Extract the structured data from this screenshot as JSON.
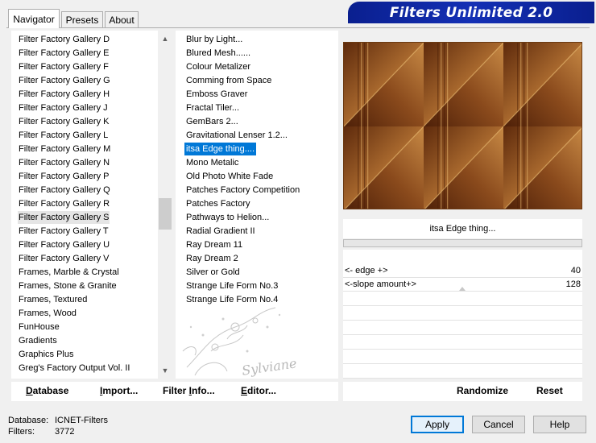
{
  "tabs": [
    {
      "label": "Navigator"
    },
    {
      "label": "Presets"
    },
    {
      "label": "About"
    }
  ],
  "banner": {
    "title": "Filters Unlimited 2.0"
  },
  "categories": [
    {
      "label": "Filter Factory Gallery D"
    },
    {
      "label": "Filter Factory Gallery E"
    },
    {
      "label": "Filter Factory Gallery F"
    },
    {
      "label": "Filter Factory Gallery G"
    },
    {
      "label": "Filter Factory Gallery H"
    },
    {
      "label": "Filter Factory Gallery J"
    },
    {
      "label": "Filter Factory Gallery K"
    },
    {
      "label": "Filter Factory Gallery L"
    },
    {
      "label": "Filter Factory Gallery M"
    },
    {
      "label": "Filter Factory Gallery N"
    },
    {
      "label": "Filter Factory Gallery P"
    },
    {
      "label": "Filter Factory Gallery Q"
    },
    {
      "label": "Filter Factory Gallery R"
    },
    {
      "label": "Filter Factory Gallery S"
    },
    {
      "label": "Filter Factory Gallery T"
    },
    {
      "label": "Filter Factory Gallery U"
    },
    {
      "label": "Filter Factory Gallery V"
    },
    {
      "label": "Frames, Marble & Crystal"
    },
    {
      "label": "Frames, Stone & Granite"
    },
    {
      "label": "Frames, Textured"
    },
    {
      "label": "Frames, Wood"
    },
    {
      "label": "FunHouse"
    },
    {
      "label": "Gradients"
    },
    {
      "label": "Graphics Plus"
    },
    {
      "label": "Greg's Factory Output Vol. II"
    }
  ],
  "selected_category": "Filter Factory Gallery S",
  "filters": [
    {
      "label": "Blur by Light..."
    },
    {
      "label": "Blured Mesh......"
    },
    {
      "label": "Colour Metalizer"
    },
    {
      "label": "Comming from Space"
    },
    {
      "label": "Emboss Graver"
    },
    {
      "label": "Fractal Tiler..."
    },
    {
      "label": "GemBars 2..."
    },
    {
      "label": "Gravitational Lenser 1.2..."
    },
    {
      "label": "itsa Edge thing...."
    },
    {
      "label": "Mono Metalic"
    },
    {
      "label": "Old Photo White Fade"
    },
    {
      "label": "Patches Factory Competition"
    },
    {
      "label": "Patches Factory"
    },
    {
      "label": "Pathways to Helion..."
    },
    {
      "label": "Radial Gradient II"
    },
    {
      "label": "Ray Dream 11"
    },
    {
      "label": "Ray Dream 2"
    },
    {
      "label": "Silver or Gold"
    },
    {
      "label": "Strange Life Form No.3"
    },
    {
      "label": "Strange Life Form No.4"
    }
  ],
  "selected_filter": "itsa Edge thing....",
  "watermark": {
    "text": "Sylviane"
  },
  "effect": {
    "name": "itsa Edge thing..."
  },
  "parameters": [
    {
      "label": "<- edge +>",
      "value": "40"
    },
    {
      "label": "<-slope amount+>",
      "value": "128"
    }
  ],
  "toolbar": {
    "database": {
      "first": "D",
      "rest": "atabase"
    },
    "import": {
      "first": "I",
      "rest": "mport..."
    },
    "filter_info": {
      "first": "Filter ",
      "underlined": "I",
      "rest": "nfo..."
    },
    "editor": {
      "first": "E",
      "rest": "ditor..."
    },
    "randomize": "Randomize",
    "reset": "Reset"
  },
  "status": {
    "database_label": "Database:",
    "database_value": "ICNET-Filters",
    "filters_label": "Filters:",
    "filters_value": "3772"
  },
  "buttons": {
    "apply": "Apply",
    "cancel": "Cancel",
    "help": "Help"
  },
  "colors": {
    "banner": "#1430b5",
    "selection": "#0078d7",
    "preview_base": "#8b4e1e"
  }
}
